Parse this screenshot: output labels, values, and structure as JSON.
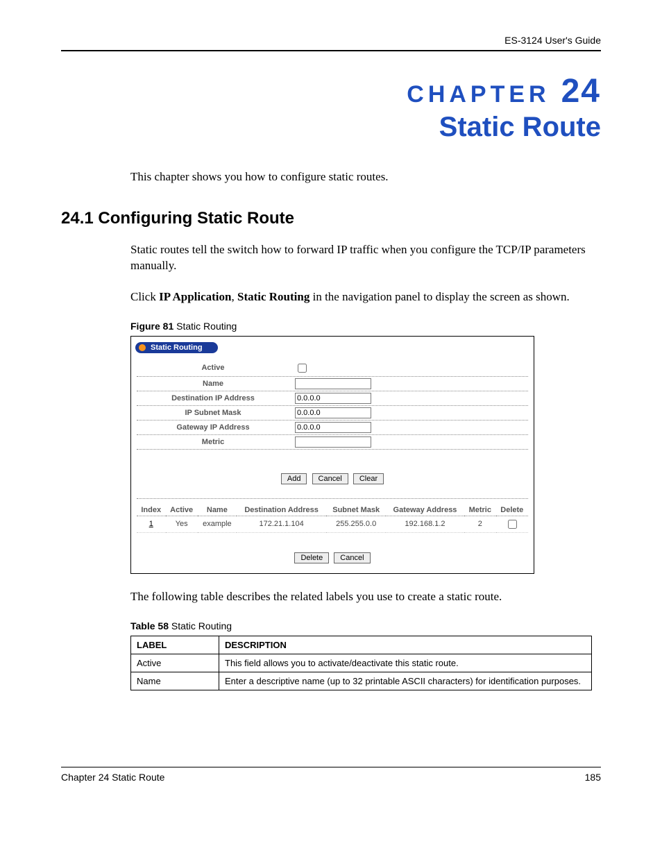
{
  "header": {
    "doc_title": "ES-3124 User's Guide"
  },
  "chapter": {
    "label": "CHAPTER",
    "number": "24",
    "title": "Static Route"
  },
  "intro": "This chapter shows you how to configure static routes.",
  "section": {
    "heading": "24.1  Configuring Static Route",
    "p1": "Static routes tell the switch how to forward IP traffic when you configure the TCP/IP parameters manually.",
    "p2_pre": "Click ",
    "p2_b1": "IP Application",
    "p2_mid": ", ",
    "p2_b2": "Static Routing",
    "p2_post": " in the navigation panel to display the screen as shown."
  },
  "figure": {
    "caption_bold": "Figure 81",
    "caption_rest": "   Static Routing"
  },
  "screenshot": {
    "panel_title": "Static Routing",
    "form": {
      "active_label": "Active",
      "name_label": "Name",
      "name_value": "",
      "dest_label": "Destination IP Address",
      "dest_value": "0.0.0.0",
      "mask_label": "IP Subnet Mask",
      "mask_value": "0.0.0.0",
      "gw_label": "Gateway IP Address",
      "gw_value": "0.0.0.0",
      "metric_label": "Metric",
      "metric_value": ""
    },
    "buttons": {
      "add": "Add",
      "cancel": "Cancel",
      "clear": "Clear",
      "delete": "Delete",
      "cancel2": "Cancel"
    },
    "table": {
      "headers": {
        "index": "Index",
        "active": "Active",
        "name": "Name",
        "dest": "Destination Address",
        "mask": "Subnet Mask",
        "gw": "Gateway Address",
        "metric": "Metric",
        "delete": "Delete"
      },
      "rows": [
        {
          "index": "1",
          "active": "Yes",
          "name": "example",
          "dest": "172.21.1.104",
          "mask": "255.255.0.0",
          "gw": "192.168.1.2",
          "metric": "2"
        }
      ]
    }
  },
  "after_fig": "The following table describes the related labels you use to create a static route.",
  "table_caption": {
    "bold": "Table 58",
    "rest": "   Static Routing"
  },
  "desc_table": {
    "h_label": "LABEL",
    "h_desc": "DESCRIPTION",
    "rows": [
      {
        "label": "Active",
        "desc": "This field allows you to activate/deactivate this static route."
      },
      {
        "label": "Name",
        "desc": "Enter a descriptive name (up to 32 printable ASCII characters) for identification purposes."
      }
    ]
  },
  "footer": {
    "left": "Chapter 24 Static Route",
    "right": "185"
  }
}
